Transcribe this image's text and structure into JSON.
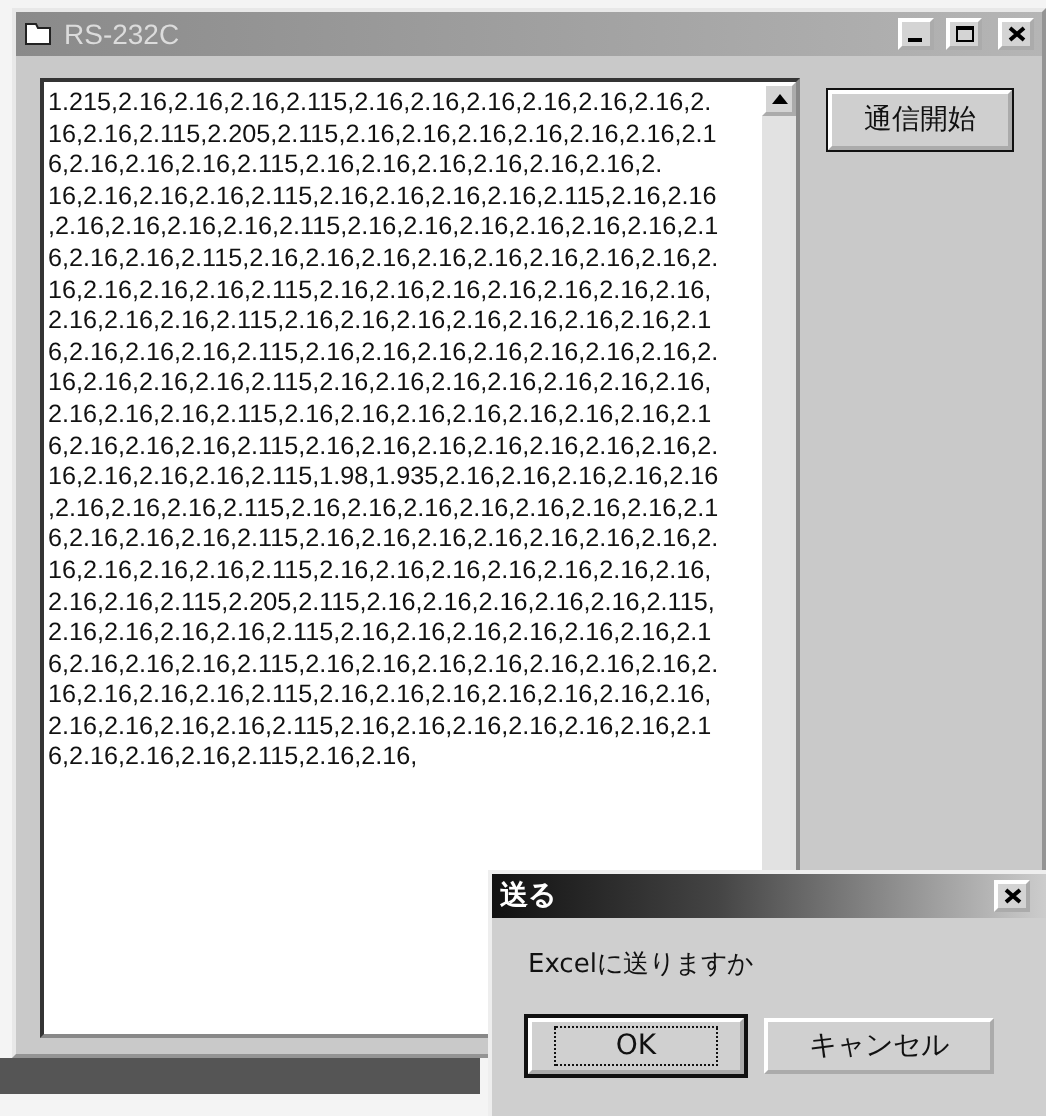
{
  "window": {
    "title": "RS-232C"
  },
  "received_data": {
    "lines": [
      "1.215,2.16,2.16,2.16,2.115,2.16,2.16,2.16,2.16,2.16,2.16,2.",
      "16,2.16,2.115,2.205,2.115,2.16,2.16,2.16,2.16,2.16,2.16,2.1",
      "6,2.16,2.16,2.16,2.115,2.16,2.16,2.16,2.16,2.16,2.16,2.",
      "16,2.16,2.16,2.16,2.115,2.16,2.16,2.16,2.16,2.115,2.16,2.16",
      ",2.16,2.16,2.16,2.16,2.115,2.16,2.16,2.16,2.16,2.16,2.16,2.1",
      "6,2.16,2.16,2.115,2.16,2.16,2.16,2.16,2.16,2.16,2.16,2.16,2.",
      "16,2.16,2.16,2.16,2.115,2.16,2.16,2.16,2.16,2.16,2.16,2.16,",
      "2.16,2.16,2.16,2.115,2.16,2.16,2.16,2.16,2.16,2.16,2.16,2.1",
      "6,2.16,2.16,2.16,2.115,2.16,2.16,2.16,2.16,2.16,2.16,2.16,2.",
      "16,2.16,2.16,2.16,2.115,2.16,2.16,2.16,2.16,2.16,2.16,2.16,",
      "2.16,2.16,2.16,2.115,2.16,2.16,2.16,2.16,2.16,2.16,2.16,2.1",
      "6,2.16,2.16,2.16,2.115,2.16,2.16,2.16,2.16,2.16,2.16,2.16,2.",
      "16,2.16,2.16,2.16,2.115,1.98,1.935,2.16,2.16,2.16,2.16,2.16",
      ",2.16,2.16,2.16,2.115,2.16,2.16,2.16,2.16,2.16,2.16,2.16,2.1",
      "6,2.16,2.16,2.16,2.115,2.16,2.16,2.16,2.16,2.16,2.16,2.16,2.",
      "16,2.16,2.16,2.16,2.115,2.16,2.16,2.16,2.16,2.16,2.16,2.16,",
      "2.16,2.16,2.115,2.205,2.115,2.16,2.16,2.16,2.16,2.16,2.115,",
      "2.16,2.16,2.16,2.16,2.115,2.16,2.16,2.16,2.16,2.16,2.16,2.1",
      "6,2.16,2.16,2.16,2.115,2.16,2.16,2.16,2.16,2.16,2.16,2.16,2.",
      "16,2.16,2.16,2.16,2.115,2.16,2.16,2.16,2.16,2.16,2.16,2.16,",
      "2.16,2.16,2.16,2.16,2.115,2.16,2.16,2.16,2.16,2.16,2.16,2.1",
      "6,2.16,2.16,2.16,2.115,2.16,2.16,"
    ]
  },
  "start_button": {
    "label": "通信開始"
  },
  "dialog": {
    "title": "送る",
    "message": "Excelに送りますか",
    "buttons": [
      {
        "label": "OK",
        "selected": true
      },
      {
        "label": "キャンセル",
        "selected": false
      }
    ]
  }
}
